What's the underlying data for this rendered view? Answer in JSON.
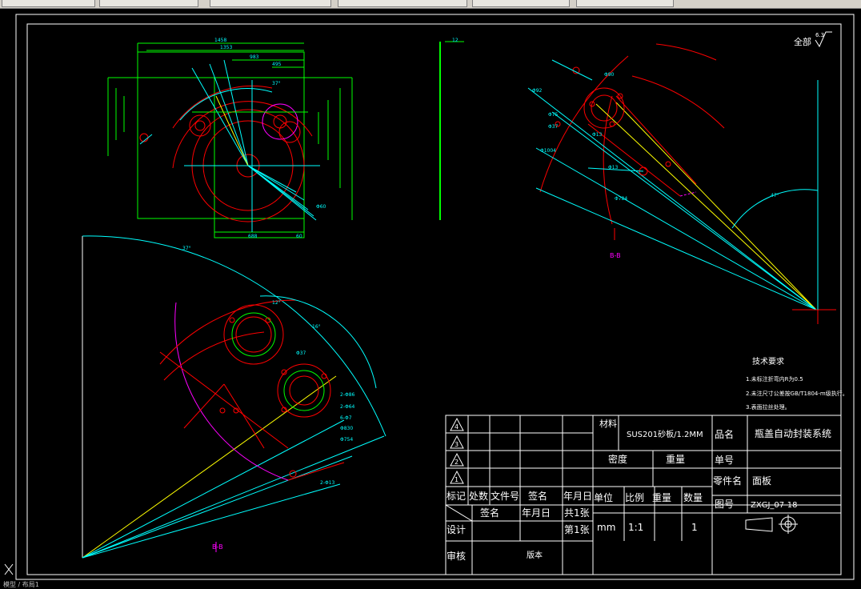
{
  "window": {
    "status_text": "模型 / 布局1"
  },
  "drawing": {
    "finish_label": "全部",
    "finish_value": "6.3",
    "tech_title": "技术要求",
    "tech_notes": [
      "1.未标注折弯内R为0.5",
      "2.未注尺寸公差按GB/T1804-m级执行。",
      "3.表面拉丝处理。"
    ],
    "view_labels": [
      "B-B",
      "B-B",
      "A"
    ],
    "angle_labels": [
      "37°",
      "47°",
      "37°",
      "16°",
      "12°"
    ],
    "dim_labels": [
      "1458",
      "1353",
      "983",
      "495",
      "2-Φ86",
      "2-Φ64",
      "6-Φ7",
      "Φ830",
      "Φ754",
      "2-Φ13",
      "Φ1004",
      "Φ784",
      "Φ13",
      "Φ90",
      "Φ92",
      "Φ75",
      "Φ37",
      "Φ13",
      "Φ60",
      "Φ37",
      "688",
      "60",
      "12"
    ]
  },
  "title_block": {
    "material_label": "材料",
    "material_value": "SUS201砂板/1.2MM",
    "product_label": "品名",
    "product_value": "瓶盖自动封装系统",
    "density_label": "密度",
    "weight_label": "重量",
    "unit_label": "单号",
    "part_label": "零件名",
    "part_value": "面板",
    "drawing_no_label": "图号",
    "drawing_no_value": "ZXGJ_07-18",
    "rev_headers": [
      "标记",
      "处数",
      "文件号",
      "签名",
      "年月日"
    ],
    "rev_marks": [
      "4",
      "3",
      "2",
      "1"
    ],
    "sign_label": "签名",
    "date_label": "年月日",
    "total_sheets": "共1张",
    "sheet_no": "第1张",
    "unit_header": "单位",
    "scale_header": "比例",
    "weight_header": "重量",
    "qty_header": "数量",
    "unit_value": "mm",
    "scale_value": "1:1",
    "qty_value": "1",
    "design_label": "设计",
    "review_label": "审核",
    "version_label": "版本"
  },
  "colors": {
    "cyan": "#00ffff",
    "red": "#ff0000",
    "green": "#00ff00",
    "yellow": "#ffff00",
    "magenta": "#ff00ff",
    "white": "#ffffff"
  }
}
